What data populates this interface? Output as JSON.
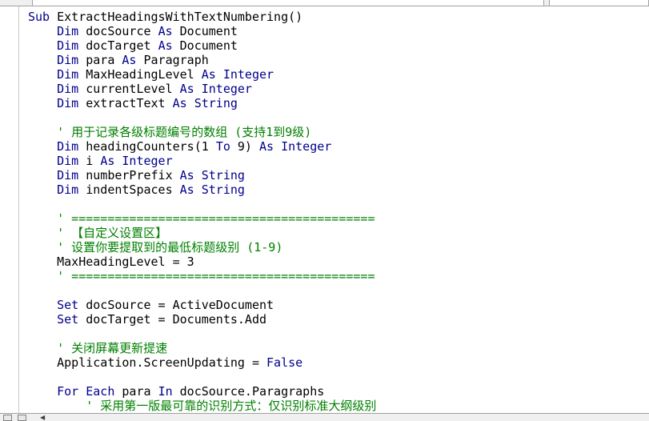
{
  "editor": {
    "lines": [
      [
        {
          "t": "Sub ",
          "c": "kw"
        },
        {
          "t": "ExtractHeadingsWithTextNumbering()"
        }
      ],
      [
        {
          "t": "    "
        },
        {
          "t": "Dim",
          "c": "kw"
        },
        {
          "t": " docSource "
        },
        {
          "t": "As",
          "c": "kw"
        },
        {
          "t": " Document"
        }
      ],
      [
        {
          "t": "    "
        },
        {
          "t": "Dim",
          "c": "kw"
        },
        {
          "t": " docTarget "
        },
        {
          "t": "As",
          "c": "kw"
        },
        {
          "t": " Document"
        }
      ],
      [
        {
          "t": "    "
        },
        {
          "t": "Dim",
          "c": "kw"
        },
        {
          "t": " para "
        },
        {
          "t": "As",
          "c": "kw"
        },
        {
          "t": " Paragraph"
        }
      ],
      [
        {
          "t": "    "
        },
        {
          "t": "Dim",
          "c": "kw"
        },
        {
          "t": " MaxHeadingLevel "
        },
        {
          "t": "As Integer",
          "c": "kw"
        }
      ],
      [
        {
          "t": "    "
        },
        {
          "t": "Dim",
          "c": "kw"
        },
        {
          "t": " currentLevel "
        },
        {
          "t": "As Integer",
          "c": "kw"
        }
      ],
      [
        {
          "t": "    "
        },
        {
          "t": "Dim",
          "c": "kw"
        },
        {
          "t": " extractText "
        },
        {
          "t": "As String",
          "c": "kw"
        }
      ],
      [],
      [
        {
          "t": "    "
        },
        {
          "t": "' 用于记录各级标题编号的数组 (支持1到9级)",
          "c": "cm"
        }
      ],
      [
        {
          "t": "    "
        },
        {
          "t": "Dim",
          "c": "kw"
        },
        {
          "t": " headingCounters(1 "
        },
        {
          "t": "To",
          "c": "kw"
        },
        {
          "t": " 9) "
        },
        {
          "t": "As Integer",
          "c": "kw"
        }
      ],
      [
        {
          "t": "    "
        },
        {
          "t": "Dim",
          "c": "kw"
        },
        {
          "t": " i "
        },
        {
          "t": "As Integer",
          "c": "kw"
        }
      ],
      [
        {
          "t": "    "
        },
        {
          "t": "Dim",
          "c": "kw"
        },
        {
          "t": " numberPrefix "
        },
        {
          "t": "As String",
          "c": "kw"
        }
      ],
      [
        {
          "t": "    "
        },
        {
          "t": "Dim",
          "c": "kw"
        },
        {
          "t": " indentSpaces "
        },
        {
          "t": "As String",
          "c": "kw"
        }
      ],
      [],
      [
        {
          "t": "    "
        },
        {
          "t": "' ==========================================",
          "c": "cm"
        }
      ],
      [
        {
          "t": "    "
        },
        {
          "t": "' 【自定义设置区】",
          "c": "cm"
        }
      ],
      [
        {
          "t": "    "
        },
        {
          "t": "' 设置你要提取到的最低标题级别 (1-9)",
          "c": "cm"
        }
      ],
      [
        {
          "t": "    "
        },
        {
          "t": "MaxHeadingLevel = 3"
        }
      ],
      [
        {
          "t": "    "
        },
        {
          "t": "' ==========================================",
          "c": "cm"
        }
      ],
      [],
      [
        {
          "t": "    "
        },
        {
          "t": "Set",
          "c": "kw"
        },
        {
          "t": " docSource = ActiveDocument"
        }
      ],
      [
        {
          "t": "    "
        },
        {
          "t": "Set",
          "c": "kw"
        },
        {
          "t": " docTarget = Documents.Add"
        }
      ],
      [],
      [
        {
          "t": "    "
        },
        {
          "t": "' 关闭屏幕更新提速",
          "c": "cm"
        }
      ],
      [
        {
          "t": "    "
        },
        {
          "t": "Application.ScreenUpdating = "
        },
        {
          "t": "False",
          "c": "kw"
        }
      ],
      [],
      [
        {
          "t": "    "
        },
        {
          "t": "For Each",
          "c": "kw"
        },
        {
          "t": " para "
        },
        {
          "t": "In",
          "c": "kw"
        },
        {
          "t": " docSource.Paragraphs"
        }
      ],
      [
        {
          "t": "        "
        },
        {
          "t": "' 采用第一版最可靠的识别方式：仅识别标准大纲级别",
          "c": "cm"
        }
      ]
    ]
  }
}
